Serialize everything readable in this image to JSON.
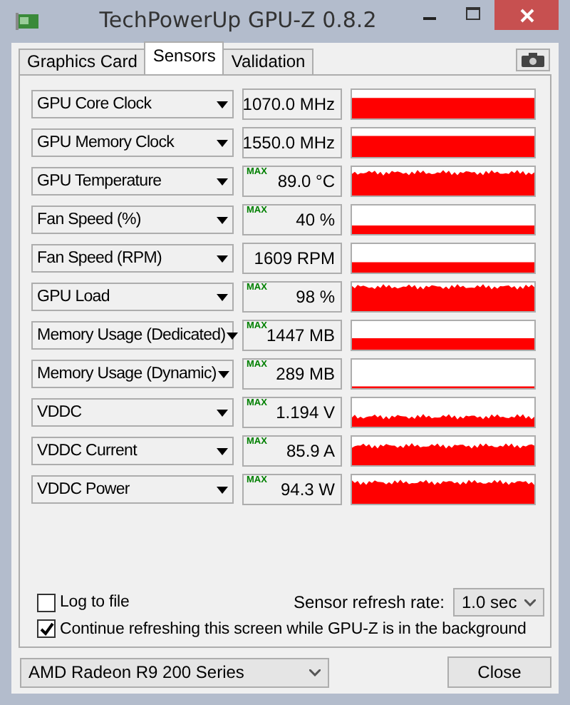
{
  "window": {
    "title": "TechPowerUp GPU-Z 0.8.2"
  },
  "tabs": [
    {
      "label": "Graphics Card",
      "selected": false
    },
    {
      "label": "Sensors",
      "selected": true
    },
    {
      "label": "Validation",
      "selected": false
    }
  ],
  "sensors": [
    {
      "name": "GPU Core Clock",
      "value": "1070.0 MHz",
      "kind": "flat"
    },
    {
      "name": "GPU Memory Clock",
      "value": "1550.0 MHz",
      "kind": "flat"
    },
    {
      "name": "GPU Temperature",
      "mode": "MAX",
      "value": "89.0 °C",
      "kind": "noisy"
    },
    {
      "name": "Fan Speed (%)",
      "mode": "MAX",
      "value": "40 %",
      "kind": "flat"
    },
    {
      "name": "Fan Speed (RPM)",
      "value": "1609 RPM",
      "kind": "flat"
    },
    {
      "name": "GPU Load",
      "mode": "MAX",
      "value": "98 %",
      "kind": "noisy"
    },
    {
      "name": "Memory Usage (Dedicated)",
      "mode": "MAX",
      "value": "1447 MB",
      "kind": "flat"
    },
    {
      "name": "Memory Usage (Dynamic)",
      "mode": "MAX",
      "value": "289 MB",
      "kind": "flat"
    },
    {
      "name": "VDDC",
      "mode": "MAX",
      "value": "1.194 V",
      "kind": "noisy"
    },
    {
      "name": "VDDC Current",
      "mode": "MAX",
      "value": "85.9 A",
      "kind": "noisy"
    },
    {
      "name": "VDDC Power",
      "mode": "MAX",
      "value": "94.3 W",
      "kind": "noisy"
    }
  ],
  "log_to_file": {
    "label": "Log to file",
    "checked": false
  },
  "refresh": {
    "label": "Sensor refresh rate:",
    "value": "1.0 sec"
  },
  "continue_refreshing": {
    "label": "Continue refreshing this screen while GPU-Z is in the background",
    "checked": true
  },
  "gpu_select": {
    "value": "AMD Radeon R9 200 Series"
  },
  "close_button": {
    "label": "Close"
  }
}
